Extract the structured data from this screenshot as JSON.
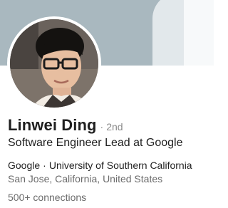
{
  "profile": {
    "name": "Linwei Ding",
    "separator": "·",
    "degree": "2nd",
    "headline": "Software Engineer Lead at Google",
    "company": "Google",
    "school_separator": "·",
    "school": "University of Southern California",
    "location": "San Jose, California, United States",
    "connections": "500+ connections"
  },
  "colors": {
    "banner": "#a9b8bf",
    "banner_light": "#e2e8eb",
    "text_primary": "#1f1f1f",
    "text_secondary": "#6b6b6b"
  },
  "icons": {
    "avatar": "profile-photo"
  }
}
